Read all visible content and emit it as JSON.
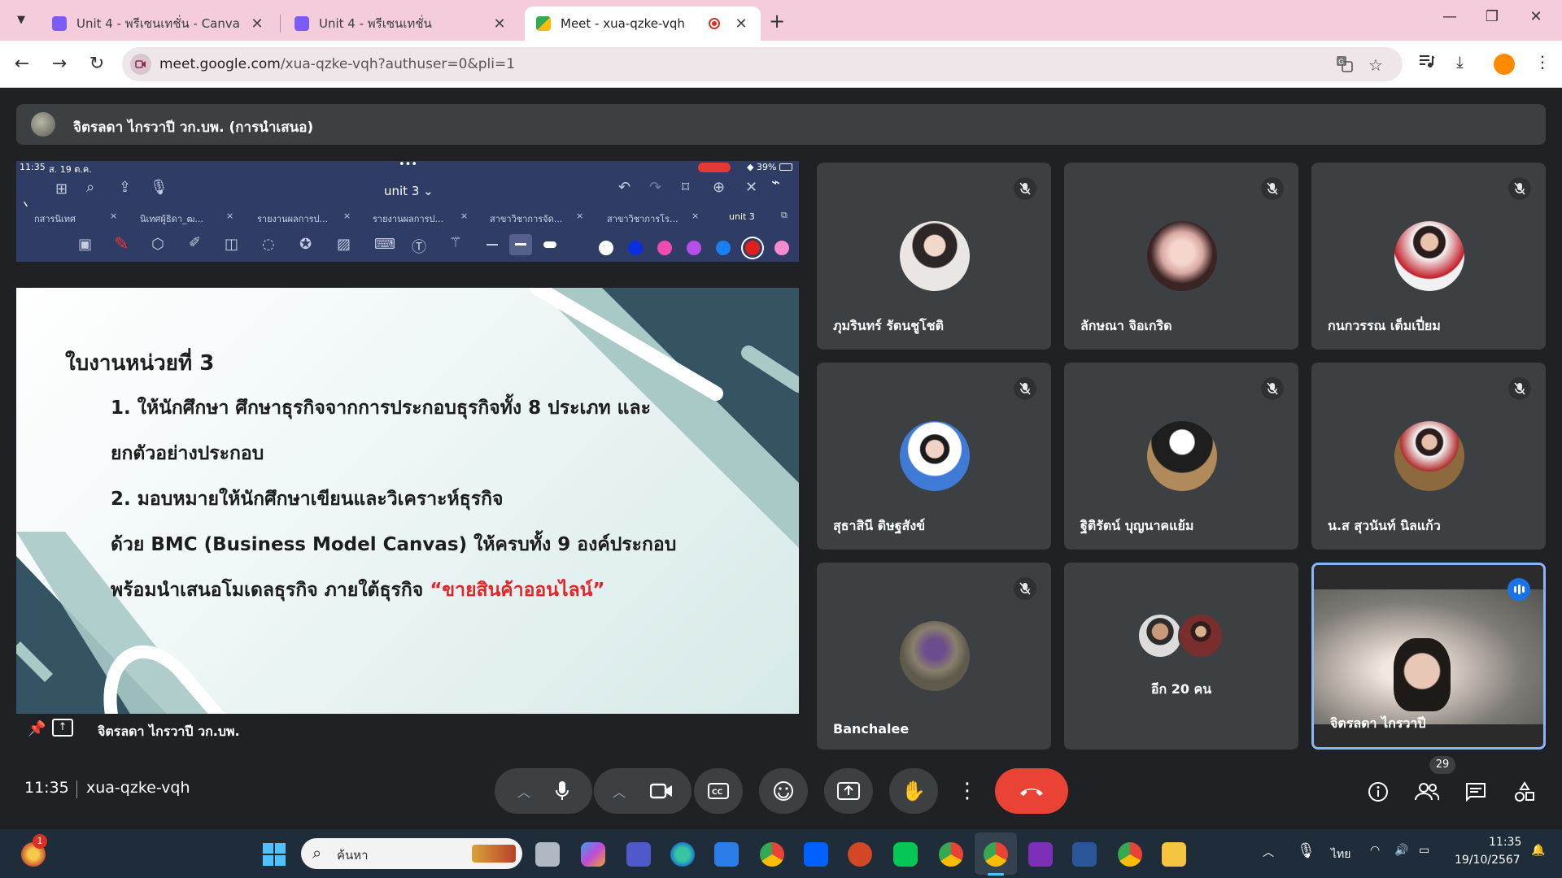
{
  "browser": {
    "tabs": [
      {
        "title": "Unit 4 - พรีเซนเทชั่น - Canva",
        "active": false
      },
      {
        "title": "Unit 4 - พรีเซนเทชั่น",
        "active": false
      },
      {
        "title": "Meet - xua-qzke-vqh",
        "active": true
      }
    ],
    "url_host": "meet.google.com",
    "url_path": "/xua-qzke-vqh?authuser=0&pli=1"
  },
  "presenter_bar": {
    "name": "จิตรลดา ไกรวาปี วก.บพ. (การนำเสนอ)"
  },
  "shared_screen": {
    "status_time": "11:35",
    "status_date": "ส. 19 ต.ค.",
    "battery": "39%",
    "doc_title": "unit 3 ⌄",
    "doc_tabs": [
      "กสารนิเทศ",
      "นิเทศผู้ธิดา_ฒ...",
      "รายงานผลการป...",
      "รายงานผลการป...",
      "สาขาวิชาการจัด...",
      "สาขาวิชาการโร...",
      "unit 3"
    ],
    "slide": {
      "heading": "ใบงานหน่วยที่ 3",
      "line1": "1. ให้นักศึกษา ศึกษาธุรกิจจากการประกอบธุรกิจทั้ง 8 ประเภท และ",
      "line2": "ยกตัวอย่างประกอบ",
      "line3": "2. มอบหมายให้นักศึกษาเขียนและวิเคราะห์ธุรกิจ",
      "line4": "ด้วย BMC (Business Model Canvas) ให้ครบทั้ง 9 องค์ประกอบ",
      "line5": "พร้อมนำเสนอโมเดลธุรกิจ ภายใต้ธุรกิจ",
      "line5_highlight": "“ขายสินค้าออนไลน์”"
    },
    "footer_name": "จิตรลดา ไกรวาปี วก.บพ."
  },
  "participants": [
    {
      "name": "ภุมรินทร์ รัตนชูโชติ",
      "muted": true
    },
    {
      "name": "ลักษณา จิอเกริด",
      "muted": true
    },
    {
      "name": "กนกวรรณ เต็มเปี่ยม",
      "muted": true
    },
    {
      "name": "สุธาสินี ดิษฐสังข์",
      "muted": true
    },
    {
      "name": "ฐิติรัตน์ บุญนาคแย้ม",
      "muted": true
    },
    {
      "name": "น.ส สุวนันท์ นิลแก้ว",
      "muted": true
    },
    {
      "name": "Banchalee",
      "muted": true
    },
    {
      "name": "อีก 20 คน",
      "muted": false
    },
    {
      "name": "จิตรลดา ไกรวาปี",
      "muted": false
    }
  ],
  "meeting": {
    "time": "11:35",
    "code": "xua-qzke-vqh",
    "people_count": "29"
  },
  "taskbar": {
    "search_placeholder": "ค้นหา",
    "notification_badge": "1",
    "language": "ไทย",
    "clock_time": "11:35",
    "clock_date": "19/10/2567"
  },
  "colors": {
    "tabbar": "#f5ccdc",
    "meet_bg": "#202124",
    "tile_bg": "#3c4043",
    "end_call": "#ea4335",
    "slide_accent": "#e0262b",
    "ipad_toolbar": "#2f3d66"
  }
}
